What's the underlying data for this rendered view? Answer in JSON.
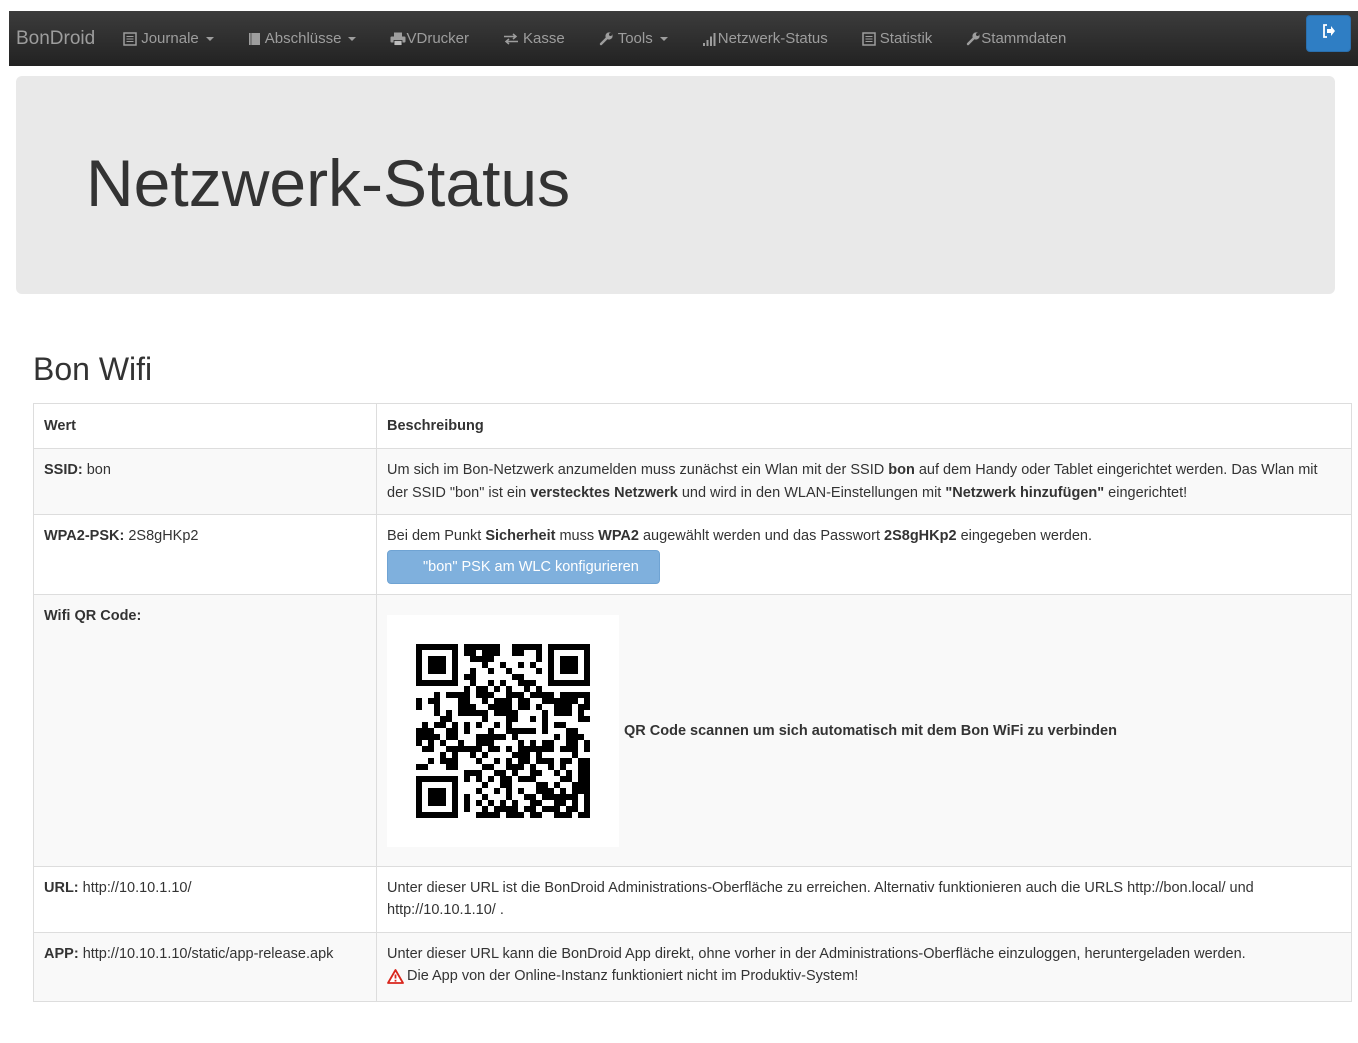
{
  "nav": {
    "brand": "BonDroid",
    "items": [
      {
        "label": "Journale",
        "icon": "list-icon",
        "dropdown": true
      },
      {
        "label": "Abschlüsse",
        "icon": "book-icon",
        "dropdown": true
      },
      {
        "label": "VDrucker",
        "icon": "printer-icon",
        "dropdown": false
      },
      {
        "label": "Kasse",
        "icon": "transfer-icon",
        "dropdown": false
      },
      {
        "label": "Tools",
        "icon": "wrench-icon",
        "dropdown": true
      },
      {
        "label": "Netzwerk-Status",
        "icon": "signal-icon",
        "dropdown": false
      },
      {
        "label": "Statistik",
        "icon": "list-icon",
        "dropdown": false
      },
      {
        "label": "Stammdaten",
        "icon": "wrench-icon",
        "dropdown": false
      }
    ],
    "logout_icon": "logout-icon"
  },
  "page": {
    "title": "Netzwerk-Status",
    "section_title": "Bon Wifi"
  },
  "table": {
    "headers": {
      "value": "Wert",
      "description": "Beschreibung"
    },
    "ssid": {
      "label": "SSID:",
      "value": "bon",
      "desc_1": "Um sich im Bon-Netzwerk anzumelden muss zunächst ein Wlan mit der SSID ",
      "desc_bold_1": "bon",
      "desc_2": " auf dem Handy oder Tablet eingerichtet werden. Das Wlan mit der SSID \"bon\" ist ein ",
      "desc_bold_2": "verstecktes Netzwerk",
      "desc_3": " und wird in den WLAN-Einstellungen mit ",
      "desc_bold_3": "\"Netzwerk hinzufügen\"",
      "desc_4": " eingerichtet!"
    },
    "psk": {
      "label": "WPA2-PSK:",
      "value": "2S8gHKp2",
      "desc_1": "Bei dem Punkt ",
      "desc_bold_1": "Sicherheit",
      "desc_2": " muss ",
      "desc_bold_2": "WPA2",
      "desc_3": " augewählt werden und das Passwort ",
      "desc_bold_3": "2S8gHKp2",
      "desc_4": " eingegeben werden.",
      "button_label": "\"bon\" PSK am WLC konfigurieren"
    },
    "qr": {
      "label": "Wifi QR Code:",
      "caption": "QR Code scannen um sich automatisch mit dem Bon WiFi zu verbinden"
    },
    "url": {
      "label": "URL:",
      "value": "http://10.10.1.10/",
      "desc": "Unter dieser URL ist die BonDroid Administrations-Oberfläche zu erreichen. Alternativ funktionieren auch die URLS http://bon.local/ und http://10.10.1.10/ ."
    },
    "app": {
      "label": "APP:",
      "value": "http://10.10.1.10/static/app-release.apk",
      "desc": "Unter dieser URL kann die BonDroid App direkt, ohne vorher in der Administrations-Oberfläche einzuloggen, heruntergeladen werden.",
      "warning": "Die App von der Online-Instanz funktioniert nicht im Produktiv-System!",
      "warning_icon": "warning-triangle-icon"
    }
  },
  "colors": {
    "navbar": "#222222",
    "jumbotron": "#e9e9e9",
    "primary_button": "#2f7ec4",
    "disabled_button": "#7fb0dd",
    "warning": "#d9261c"
  }
}
